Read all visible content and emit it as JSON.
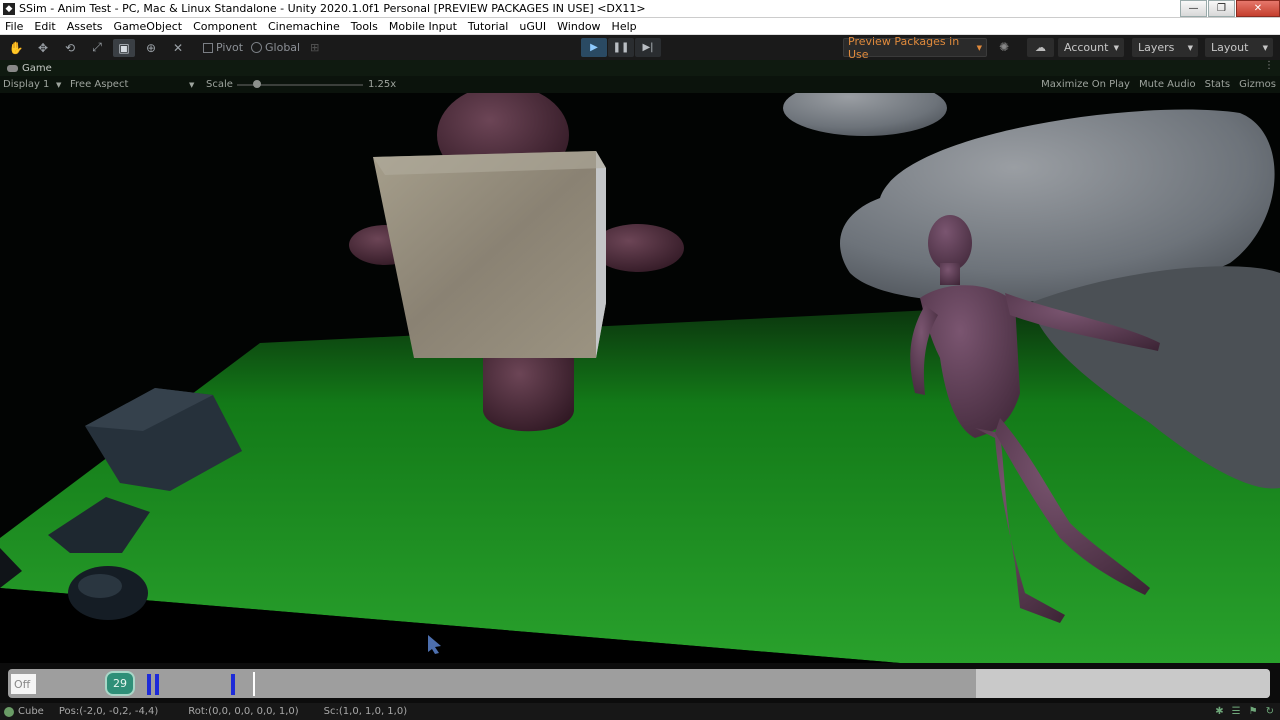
{
  "window": {
    "title": "SSim - Anim Test - PC, Mac & Linux Standalone - Unity 2020.1.0f1 Personal [PREVIEW PACKAGES IN USE] <DX11>",
    "controls": [
      "—",
      "❐",
      "✕"
    ]
  },
  "menu": [
    "File",
    "Edit",
    "Assets",
    "GameObject",
    "Component",
    "Cinemachine",
    "Tools",
    "Mobile Input",
    "Tutorial",
    "uGUI",
    "Window",
    "Help"
  ],
  "toolbar": {
    "pivot_label": "Pivot",
    "global_label": "Global",
    "preview_packages": "Preview Packages in Use",
    "account": "Account",
    "layers": "Layers",
    "layout": "Layout"
  },
  "game_tab": {
    "label": "Game",
    "display": "Display 1",
    "aspect": "Free Aspect",
    "scale_label": "Scale",
    "scale_value": "1.25x",
    "options": [
      "Maximize On Play",
      "Mute Audio",
      "Stats",
      "Gizmos"
    ]
  },
  "timeline": {
    "off_label": "Off",
    "frame": "29"
  },
  "status": {
    "object": "Cube",
    "position": "Pos:(-2,0, -0,2, -4,4)",
    "rotation": "Rot:(0,0, 0,0, 0,0, 1,0)",
    "scale": "Sc:(1,0, 1,0, 1,0)"
  },
  "colors": {
    "floor": "#1e8a1f",
    "play_accent": "#8ecbff",
    "preview_warning": "#e08a3c",
    "frame_badge": "#2f8f78",
    "markers": "#1d2bd8"
  }
}
